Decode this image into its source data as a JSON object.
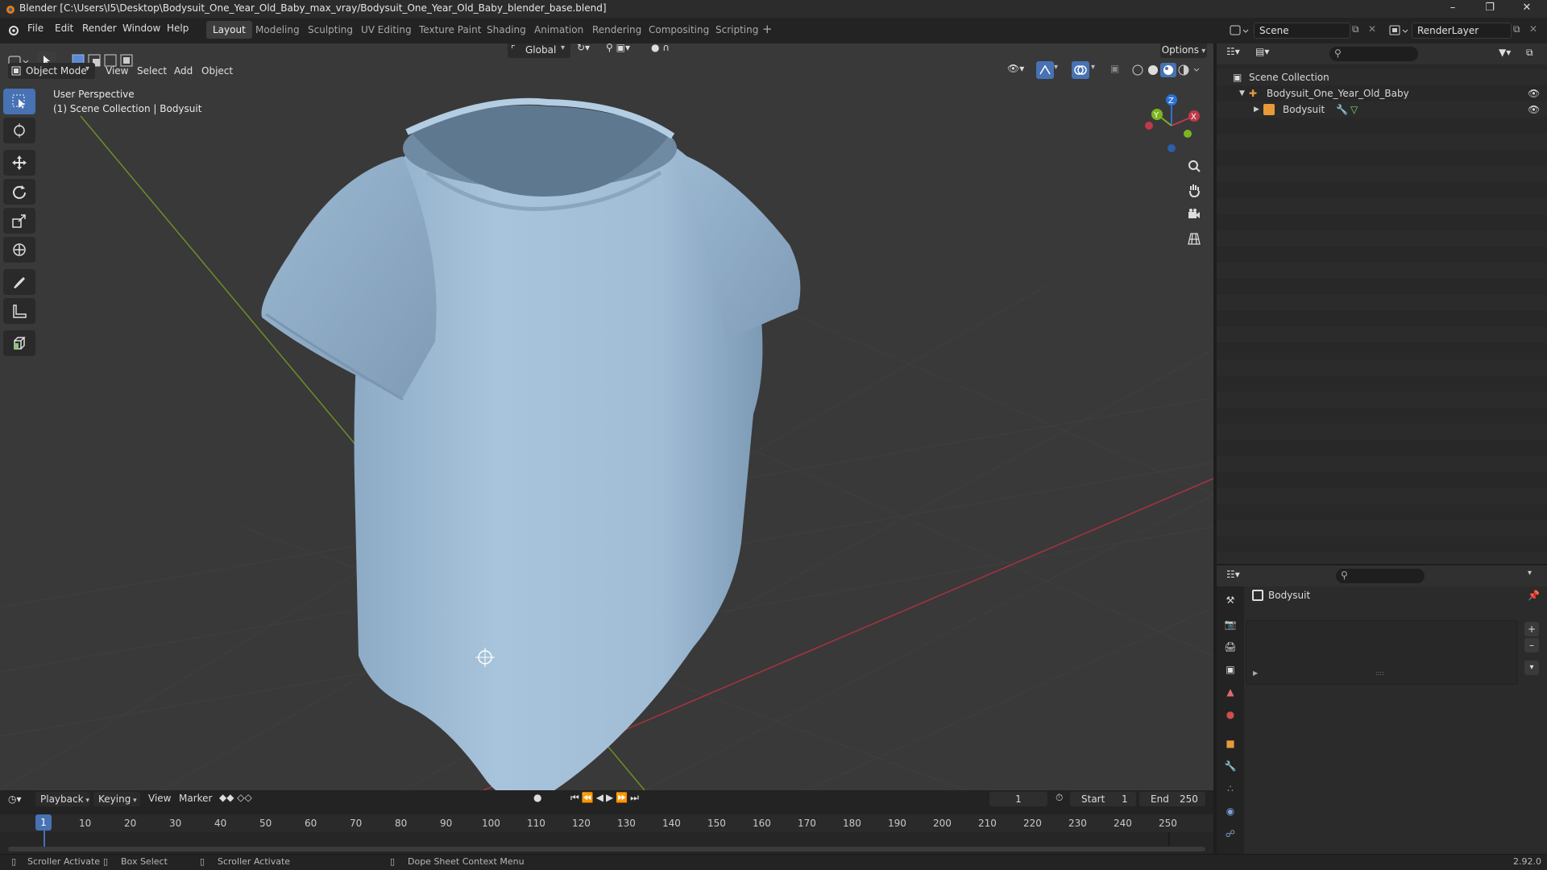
{
  "window": {
    "title": "Blender [C:\\Users\\I5\\Desktop\\Bodysuit_One_Year_Old_Baby_max_vray/Bodysuit_One_Year_Old_Baby_blender_base.blend]",
    "minimize_icon": "minimize-icon",
    "maximize_icon": "restore-icon",
    "close_icon": "close-icon"
  },
  "menu": {
    "items": [
      "File",
      "Edit",
      "Render",
      "Window",
      "Help"
    ]
  },
  "workspaces": {
    "tabs": [
      "Layout",
      "Modeling",
      "Sculpting",
      "UV Editing",
      "Texture Paint",
      "Shading",
      "Animation",
      "Rendering",
      "Compositing",
      "Scripting"
    ],
    "active": "Layout",
    "add_label": "+"
  },
  "scene": {
    "label": "Scene",
    "render_layer": "RenderLayer"
  },
  "viewport": {
    "mode": "Object Mode",
    "menus": [
      "View",
      "Select",
      "Add",
      "Object"
    ],
    "orientation": "Global",
    "options_label": "Options",
    "perspective_label": "User Perspective",
    "collection_label": "(1) Scene Collection | Bodysuit",
    "gizmo": {
      "x": "X",
      "y": "Y",
      "z": "Z"
    },
    "colors": {
      "x_axis": "#c0394a",
      "y_axis": "#7bb520",
      "z_axis": "#2d70d6",
      "mesh": "#a8c4dc"
    }
  },
  "outliner": {
    "root": "Scene Collection",
    "items": [
      {
        "label": "Bodysuit_One_Year_Old_Baby"
      },
      {
        "label": "Bodysuit"
      }
    ]
  },
  "properties": {
    "object_name": "Bodysuit",
    "list_handle": "::::"
  },
  "timeline": {
    "menus": [
      "Playback",
      "Keying",
      "View",
      "Marker"
    ],
    "current_frame": "1",
    "start_label": "Start",
    "start_value": "1",
    "end_label": "End",
    "end_value": "250",
    "ticks": [
      "1",
      "10",
      "20",
      "30",
      "40",
      "50",
      "60",
      "70",
      "80",
      "90",
      "100",
      "110",
      "120",
      "130",
      "140",
      "150",
      "160",
      "170",
      "180",
      "190",
      "200",
      "210",
      "220",
      "230",
      "240",
      "250"
    ]
  },
  "status": {
    "items": [
      "Scroller Activate",
      "Box Select",
      "Scroller Activate",
      "Dope Sheet Context Menu"
    ],
    "version": "2.92.0"
  }
}
